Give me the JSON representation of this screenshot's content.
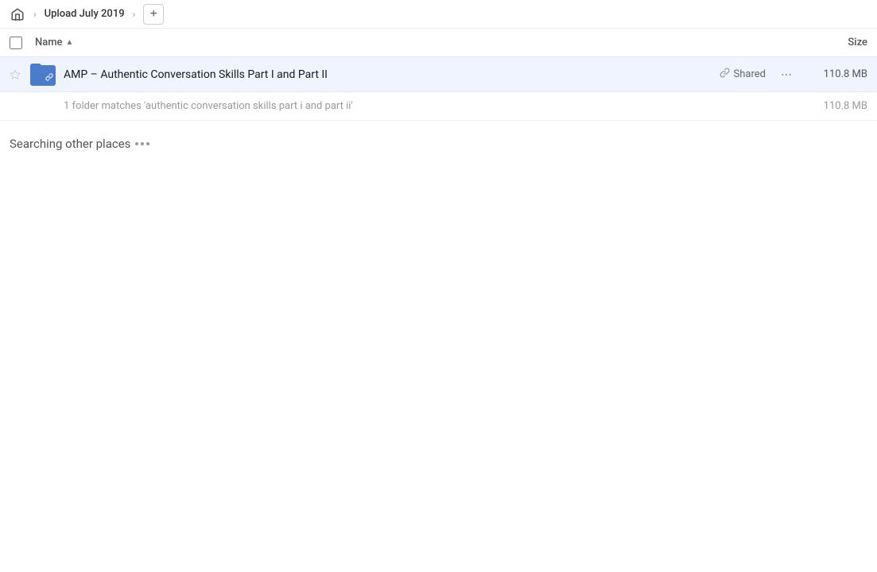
{
  "breadcrumb": {
    "home_icon": "🏠",
    "title": "Upload July 2019",
    "chevron": "›",
    "add_icon": "+"
  },
  "columns": {
    "name_label": "Name",
    "size_label": "Size",
    "sort_arrow": "▲"
  },
  "file_row": {
    "name": "AMP – Authentic Conversation Skills Part I and Part II",
    "shared_label": "Shared",
    "size": "110.8 MB",
    "more_icon": "···"
  },
  "match_row": {
    "text": "1 folder matches 'authentic conversation skills part i and part ii'",
    "size": "110.8 MB"
  },
  "searching": {
    "label": "Searching other places"
  }
}
